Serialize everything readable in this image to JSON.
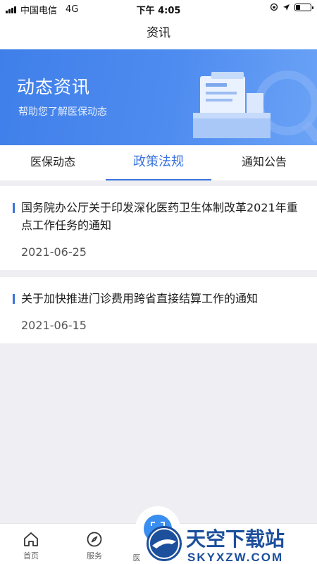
{
  "status_bar": {
    "carrier": "中国电信",
    "network": "4G",
    "time": "下午 4:05",
    "battery_level": 0.3
  },
  "nav": {
    "title": "资讯"
  },
  "banner": {
    "title": "动态资讯",
    "subtitle": "帮助您了解医保动态"
  },
  "tabs": [
    {
      "label": "医保动态",
      "active": false
    },
    {
      "label": "政策法规",
      "active": true
    },
    {
      "label": "通知公告",
      "active": false
    }
  ],
  "news": [
    {
      "title": "国务院办公厅关于印发深化医药卫生体制改革2021年重点工作任务的通知",
      "date": "2021-06-25"
    },
    {
      "title": "关于加快推进门诊费用跨省直接结算工作的通知",
      "date": "2021-06-15"
    }
  ],
  "bottom_tabs": [
    {
      "label": "首页",
      "icon": "home-icon"
    },
    {
      "label": "服务",
      "icon": "compass-icon"
    },
    {
      "label": "医",
      "icon": "scan-icon"
    }
  ],
  "watermark": {
    "text_top": "天空下载站",
    "text_bottom": "SKYXZW.COM"
  },
  "colors": {
    "accent": "#3a73de",
    "banner": "#4f8cf0",
    "background": "#efeff3"
  }
}
